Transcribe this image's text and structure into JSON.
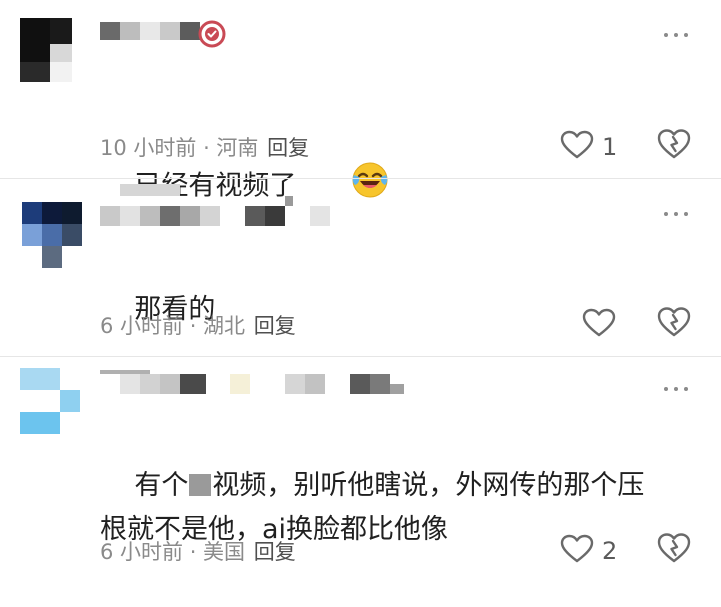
{
  "comments": [
    {
      "text": "已经有视频了",
      "emoji": "laughing-tears-emoji",
      "meta": "10 小时前 · 河南",
      "reply_label": "回复",
      "like_count": "1",
      "verified_badge": "verified-badge-icon"
    },
    {
      "text": "那看的",
      "meta": "6 小时前 · 湖北",
      "reply_label": "回复",
      "like_count": ""
    },
    {
      "text_before": "有个",
      "text_after": "视频，别听他瞎说，外网传的那个压\n根就不是他，ai换脸都比他像",
      "meta": "6 小时前 · 美国",
      "reply_label": "回复",
      "like_count": "2"
    }
  ],
  "colors": {
    "text": "#202020",
    "meta": "#8a8a8a",
    "reply": "#4f4f4f",
    "icon": "#6a6a6a",
    "badge": "#c94a55"
  },
  "icons": [
    "more-icon",
    "heart-icon",
    "dislike-icon",
    "verified-badge-icon"
  ]
}
